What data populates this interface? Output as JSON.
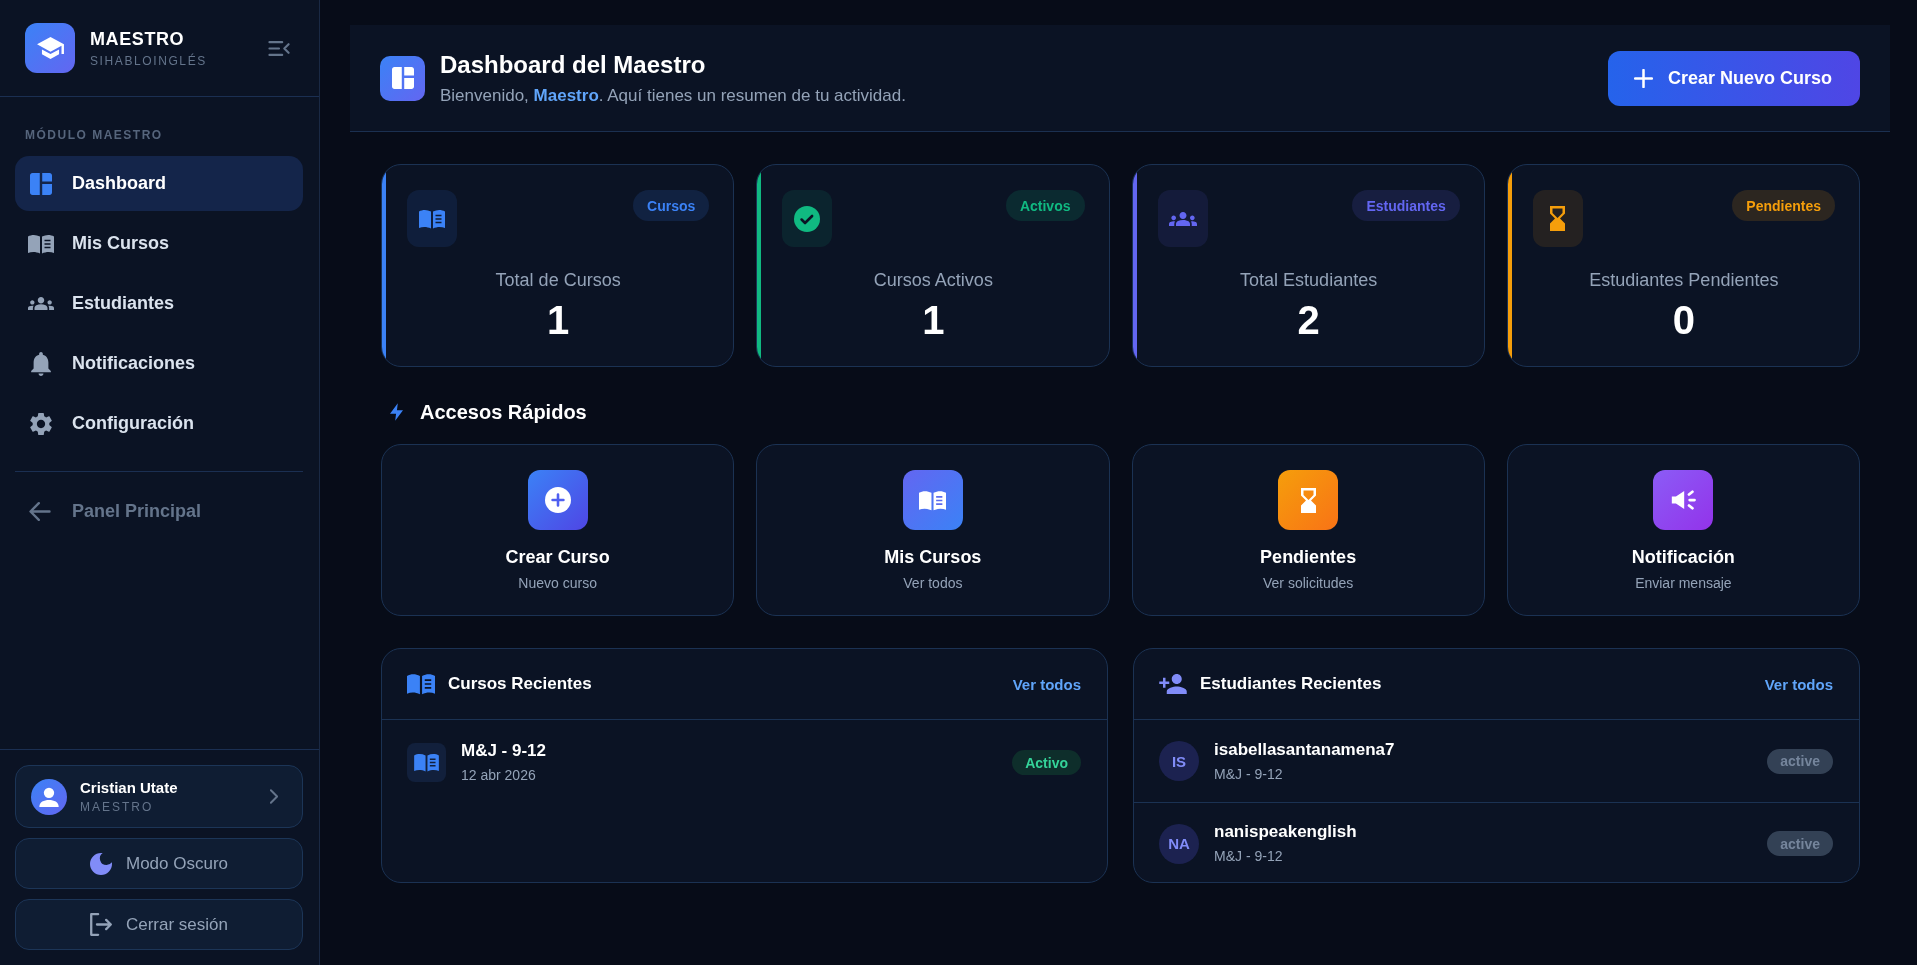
{
  "sidebar": {
    "brand": {
      "title": "MAESTRO",
      "subtitle": "SIHABLOINGLÉS"
    },
    "section_label": "MÓDULO MAESTRO",
    "items": [
      {
        "label": "Dashboard",
        "selected": true
      },
      {
        "label": "Mis Cursos",
        "selected": false
      },
      {
        "label": "Estudiantes",
        "selected": false
      },
      {
        "label": "Notificaciones",
        "selected": false
      },
      {
        "label": "Configuración",
        "selected": false
      }
    ],
    "back_link": "Panel Principal",
    "user": {
      "name": "Cristian Utate",
      "role": "MAESTRO"
    },
    "buttons": [
      "Modo Oscuro",
      "Cerrar sesión"
    ]
  },
  "header": {
    "title": "Dashboard del Maestro",
    "subtitle": "Bienvenido, **Maestro**. Aquí tienes un resumen de tu actividad.",
    "button": "Crear Nuevo Curso"
  },
  "stats": [
    {
      "badge": "Cursos",
      "label": "Total de Cursos",
      "value": "1",
      "color": "#3b82f6"
    },
    {
      "badge": "Activos",
      "label": "Cursos Activos",
      "value": "1",
      "color": "#10b981"
    },
    {
      "badge": "Estudiantes",
      "label": "Total Estudiantes",
      "value": "2",
      "color": "#6366f1"
    },
    {
      "badge": "Pendientes",
      "label": "Estudiantes Pendientes",
      "value": "0",
      "color": "#f59e0b"
    }
  ],
  "quick_access": {
    "title": "Accesos Rápidos",
    "items": [
      {
        "title": "Crear Curso",
        "subtitle": "Nuevo curso"
      },
      {
        "title": "Mis Cursos",
        "subtitle": "Ver todos"
      },
      {
        "title": "Pendientes",
        "subtitle": "Ver solicitudes"
      },
      {
        "title": "Notificación",
        "subtitle": "Enviar mensaje"
      }
    ]
  },
  "recent_courses": {
    "title": "Cursos Recientes",
    "link": "Ver todos",
    "rows": [
      {
        "name": "M&J - 9-12",
        "date": "12 abr 2026",
        "status": "Activo"
      }
    ]
  },
  "recent_students": {
    "title": "Estudiantes Recientes",
    "link": "Ver todos",
    "rows": [
      {
        "initials": "IS",
        "name": "isabellasantanamena7",
        "course": "M&J - 9-12",
        "status": "active"
      },
      {
        "initials": "NA",
        "name": "nanispeakenglish",
        "course": "M&J - 9-12",
        "status": "active"
      }
    ]
  }
}
